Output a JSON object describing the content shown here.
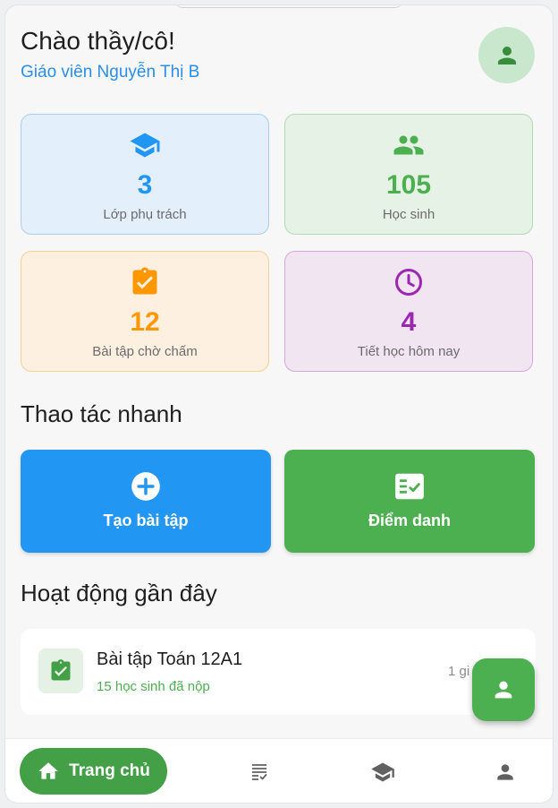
{
  "header": {
    "greeting": "Chào thầy/cô!",
    "subtitle": "Giáo viên Nguyễn Thị B",
    "avatar_icon": "person-icon"
  },
  "stats": [
    {
      "icon": "graduation-cap-icon",
      "value": "3",
      "label": "Lớp phụ trách",
      "color": "#2196f3"
    },
    {
      "icon": "people-icon",
      "value": "105",
      "label": "Học sinh",
      "color": "#4caf50"
    },
    {
      "icon": "clipboard-check-icon",
      "value": "12",
      "label": "Bài tập chờ chấm",
      "color": "#ff9800"
    },
    {
      "icon": "clock-icon",
      "value": "4",
      "label": "Tiết học hôm nay",
      "color": "#9c27b0"
    }
  ],
  "quick_actions": {
    "title": "Thao tác nhanh",
    "items": [
      {
        "icon": "add-circle-icon",
        "label": "Tạo bài tập",
        "color": "#2196f3"
      },
      {
        "icon": "fact-check-icon",
        "label": "Điểm danh",
        "color": "#4caf50"
      }
    ]
  },
  "recent_activity": {
    "title": "Hoạt động gần đây",
    "items": [
      {
        "icon": "clipboard-check-icon",
        "title": "Bài tập Toán 12A1",
        "subtitle": "15 học sinh đã nộp",
        "time": "1 gi"
      }
    ]
  },
  "fab": {
    "icon": "person-icon"
  },
  "bottom_nav": {
    "items": [
      {
        "icon": "home-icon",
        "label": "Trang chủ",
        "active": true
      },
      {
        "icon": "assignment-list-icon",
        "label": ""
      },
      {
        "icon": "graduation-cap-icon",
        "label": ""
      },
      {
        "icon": "person-icon",
        "label": ""
      }
    ]
  },
  "colors": {
    "primary_green": "#4caf50",
    "primary_blue": "#2196f3",
    "text_dark": "#1f1f1f"
  }
}
